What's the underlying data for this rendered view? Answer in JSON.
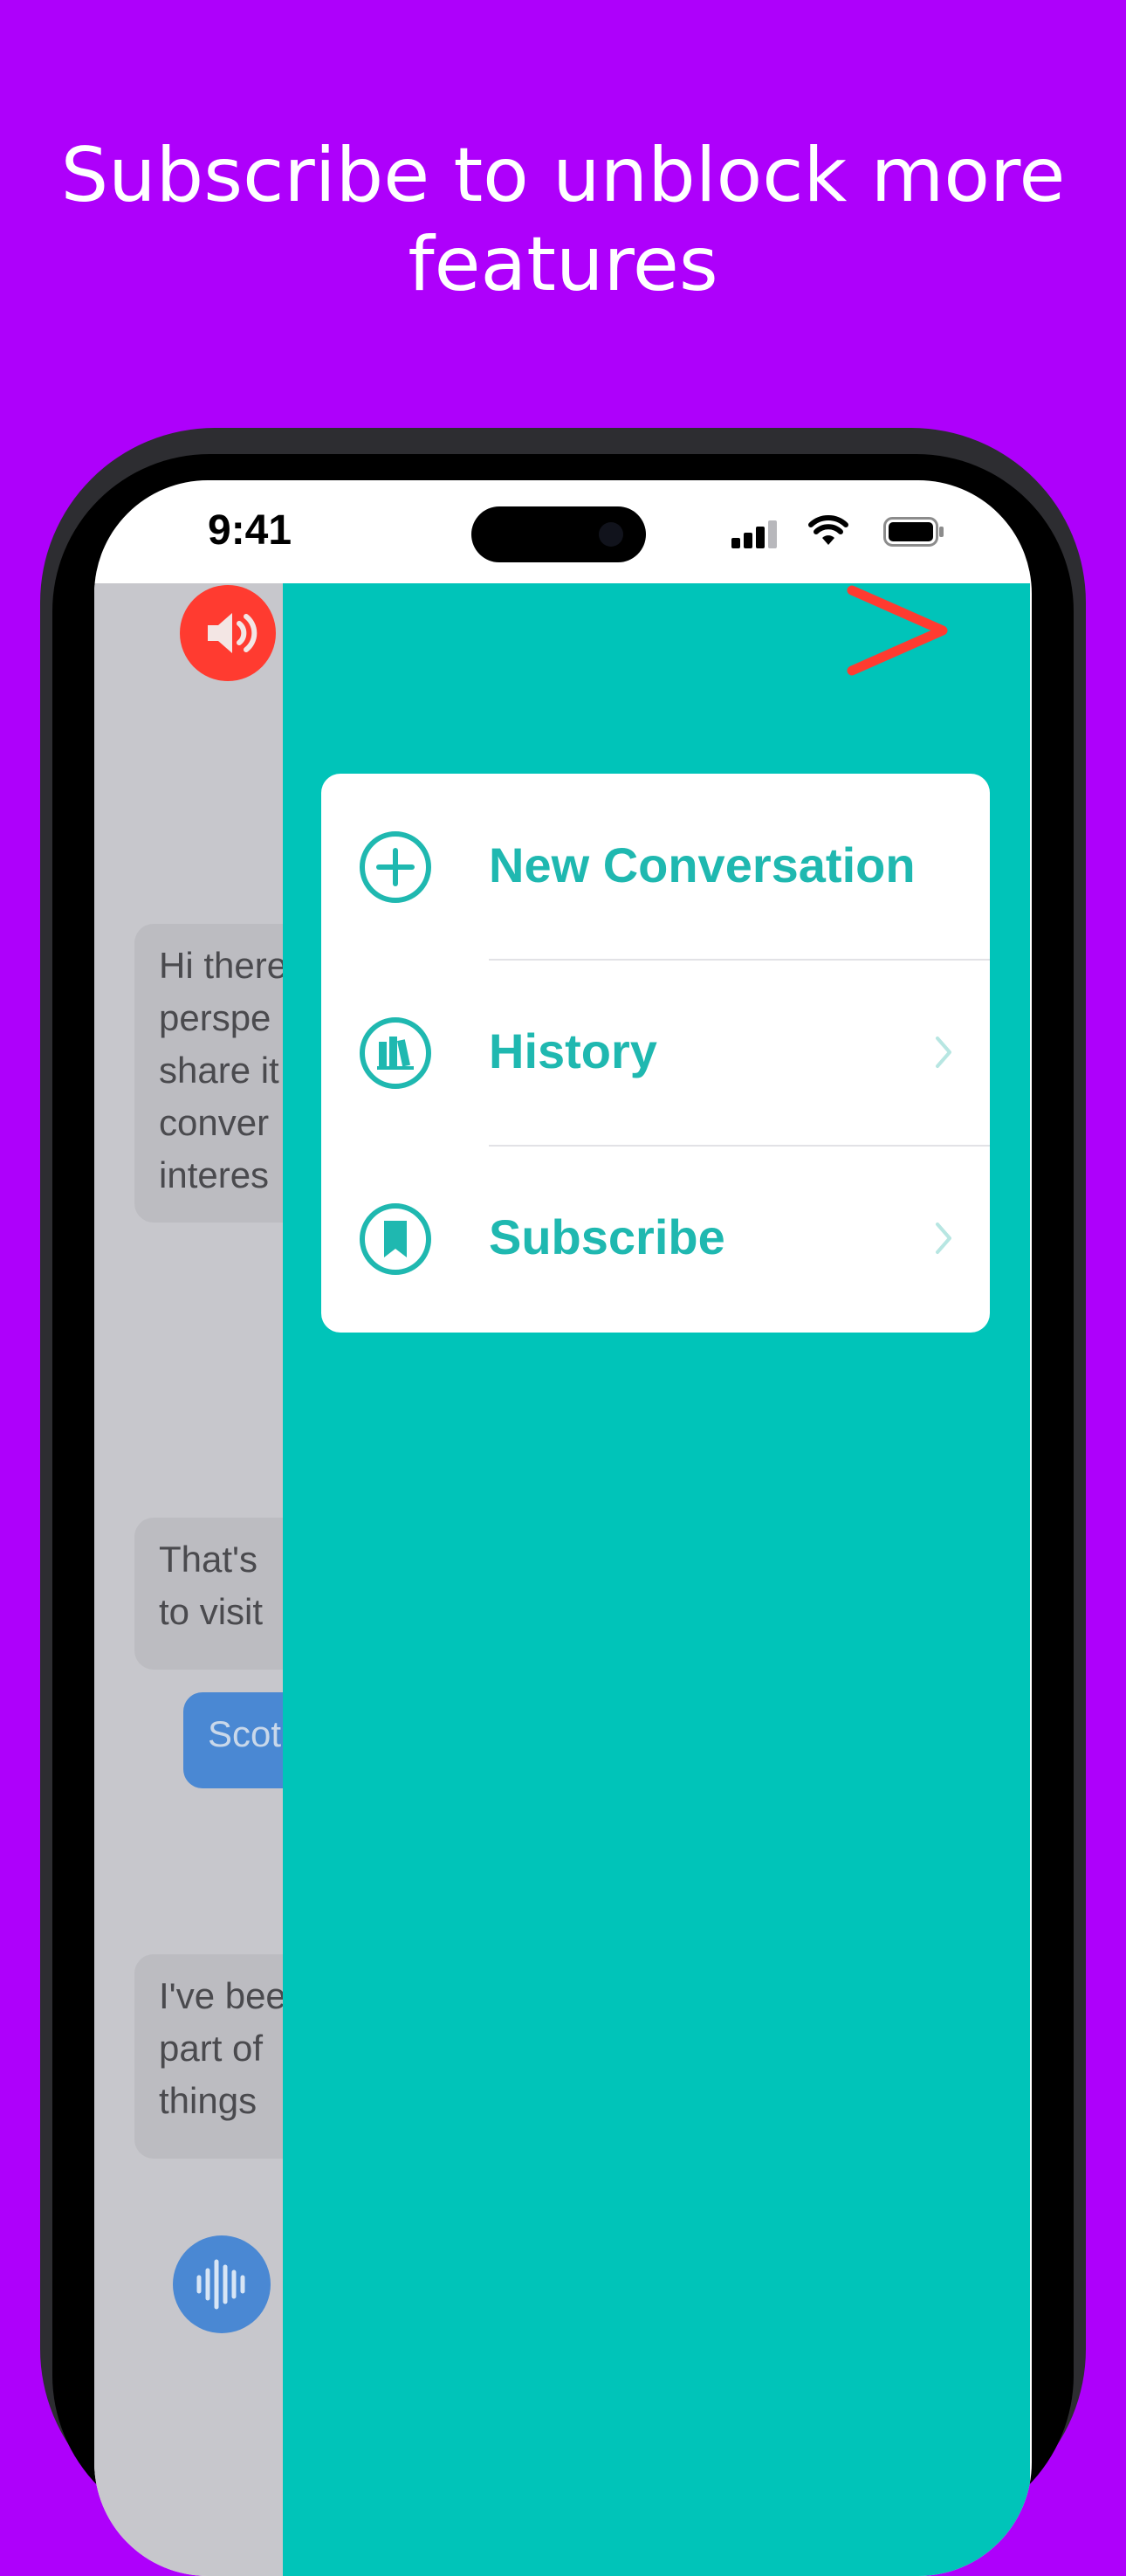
{
  "headline": "Subscribe to unblock more features",
  "status_bar": {
    "time": "9:41"
  },
  "colors": {
    "background": "#ae00fb",
    "drawer": "#00c4b9",
    "accent": "#1fb8b0",
    "speaker_button": "#ff3b30",
    "user_bubble": "#4a88d3"
  },
  "chat": {
    "messages": [
      {
        "role": "assistant",
        "text": "Hi there\nperspe\nshare it\nconver\ninteres"
      },
      {
        "role": "assistant",
        "text": "That's\nto visit"
      },
      {
        "role": "user",
        "text": "Scot"
      },
      {
        "role": "assistant",
        "text": "I've bee\npart of\nthings"
      }
    ]
  },
  "menu": {
    "items": [
      {
        "label": "New Conversation",
        "icon": "plus-circle-icon",
        "has_chevron": false
      },
      {
        "label": "History",
        "icon": "books-icon",
        "has_chevron": true
      },
      {
        "label": "Subscribe",
        "icon": "bookmark-circle-icon",
        "has_chevron": true
      }
    ]
  },
  "icons": {
    "speaker": "speaker-icon",
    "close": "chevron-right-icon",
    "voice": "waveform-icon"
  }
}
